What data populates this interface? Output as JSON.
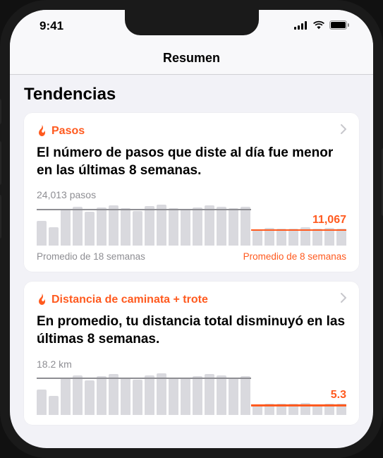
{
  "status": {
    "time": "9:41"
  },
  "nav": {
    "title": "Resumen"
  },
  "section": {
    "title": "Tendencias"
  },
  "cards": [
    {
      "title": "Pasos",
      "message": "El número de pasos que diste al día fue menor en las últimas 8 semanas.",
      "long_label": "24,013 pasos",
      "short_value": "11,067",
      "legend_long": "Promedio de 18 semanas",
      "legend_short": "Promedio de 8 semanas"
    },
    {
      "title": "Distancia de caminata + trote",
      "message": "En promedio, tu distancia total disminuyó en las últimas 8 semanas.",
      "long_label": "18.2 km",
      "short_value": "5.3",
      "legend_long": "Promedio de 18 semanas",
      "legend_short": "Promedio de 8 semanas"
    }
  ],
  "chart_data": [
    {
      "type": "bar",
      "title": "Pasos",
      "ylabel": "pasos",
      "series": [
        {
          "name": "weekly_steps",
          "values": [
            16000,
            12000,
            23500,
            25000,
            22000,
            24500,
            26000,
            24000,
            22500,
            25500,
            26500,
            24000,
            23500,
            24500,
            26000,
            25000,
            24000,
            25000,
            10500,
            11500,
            10800,
            11200,
            11800,
            10900,
            11400,
            11000
          ]
        }
      ],
      "annotations": {
        "long_avg": 24013,
        "short_avg": 11067,
        "long_weeks": 18,
        "short_weeks": 8
      },
      "ylim": [
        0,
        28000
      ]
    },
    {
      "type": "bar",
      "title": "Distancia de caminata + trote",
      "ylabel": "km",
      "series": [
        {
          "name": "weekly_distance_km",
          "values": [
            12.0,
            9.0,
            17.5,
            19.0,
            16.5,
            18.5,
            19.5,
            18.0,
            17.0,
            19.0,
            20.0,
            18.0,
            17.5,
            18.5,
            19.5,
            19.0,
            18.0,
            18.5,
            5.0,
            5.5,
            5.2,
            5.4,
            5.6,
            5.1,
            5.5,
            5.3
          ]
        }
      ],
      "annotations": {
        "long_avg": 18.2,
        "short_avg": 5.3,
        "long_weeks": 18,
        "short_weeks": 8
      },
      "ylim": [
        0,
        21
      ]
    }
  ]
}
